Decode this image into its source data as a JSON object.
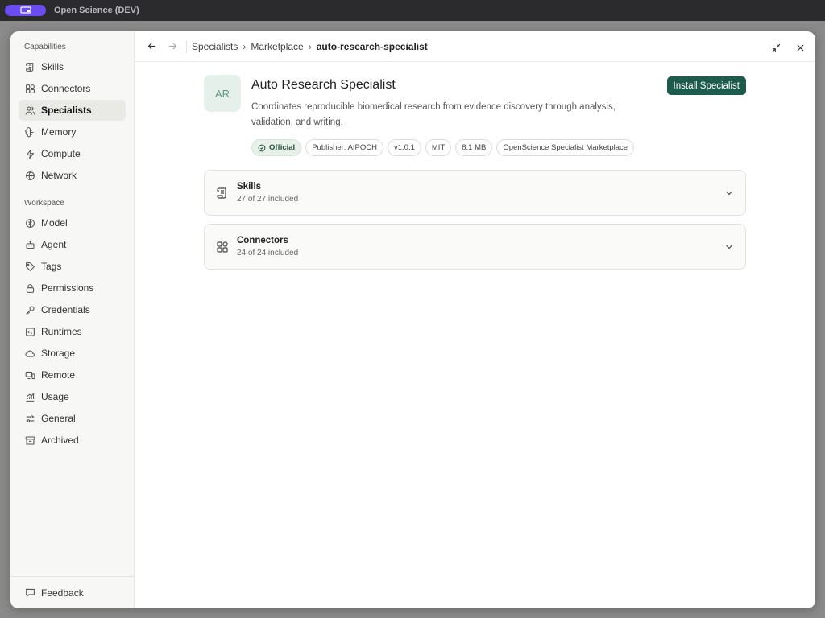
{
  "window": {
    "title": "Open Science (DEV)"
  },
  "sidebar": {
    "capabilities_label": "Capabilities",
    "capabilities": [
      {
        "label": "Skills",
        "icon": "scroll-icon"
      },
      {
        "label": "Connectors",
        "icon": "blocks-icon"
      },
      {
        "label": "Specialists",
        "icon": "users-icon",
        "active": true
      },
      {
        "label": "Memory",
        "icon": "brain-icon"
      },
      {
        "label": "Compute",
        "icon": "zap-icon"
      },
      {
        "label": "Network",
        "icon": "globe-icon"
      }
    ],
    "workspace_label": "Workspace",
    "workspace": [
      {
        "label": "Model",
        "icon": "model-icon"
      },
      {
        "label": "Agent",
        "icon": "bot-icon"
      },
      {
        "label": "Tags",
        "icon": "tags-icon"
      },
      {
        "label": "Permissions",
        "icon": "lock-icon"
      },
      {
        "label": "Credentials",
        "icon": "key-icon"
      },
      {
        "label": "Runtimes",
        "icon": "terminal-icon"
      },
      {
        "label": "Storage",
        "icon": "cloud-icon"
      },
      {
        "label": "Remote",
        "icon": "remote-icon"
      },
      {
        "label": "Usage",
        "icon": "chart-icon"
      },
      {
        "label": "General",
        "icon": "sliders-icon"
      },
      {
        "label": "Archived",
        "icon": "archive-icon"
      }
    ],
    "footer": {
      "label": "Feedback",
      "icon": "message-icon"
    }
  },
  "breadcrumb": {
    "items": [
      "Specialists",
      "Marketplace"
    ],
    "current": "auto-research-specialist",
    "separator": "›"
  },
  "specialist": {
    "initials": "AR",
    "name": "Auto Research Specialist",
    "description": "Coordinates reproducible biomedical research from evidence discovery through analysis, validation, and writing.",
    "install_label": "Install Specialist",
    "badges": {
      "official": "Official",
      "publisher": "Publisher: AIPOCH",
      "version": "v1.0.1",
      "license": "MIT",
      "size": "8.1 MB",
      "source": "OpenScience Specialist Marketplace"
    }
  },
  "sections": [
    {
      "title": "Skills",
      "subtitle": "27 of 27 included",
      "icon": "scroll-icon"
    },
    {
      "title": "Connectors",
      "subtitle": "24 of 24 included",
      "icon": "blocks-icon"
    }
  ],
  "colors": {
    "accent": "#1d5b4c",
    "official_bg": "#e7f1ea",
    "avatar_text": "#5f9c7c",
    "app_pill": "#6b4cf0"
  }
}
